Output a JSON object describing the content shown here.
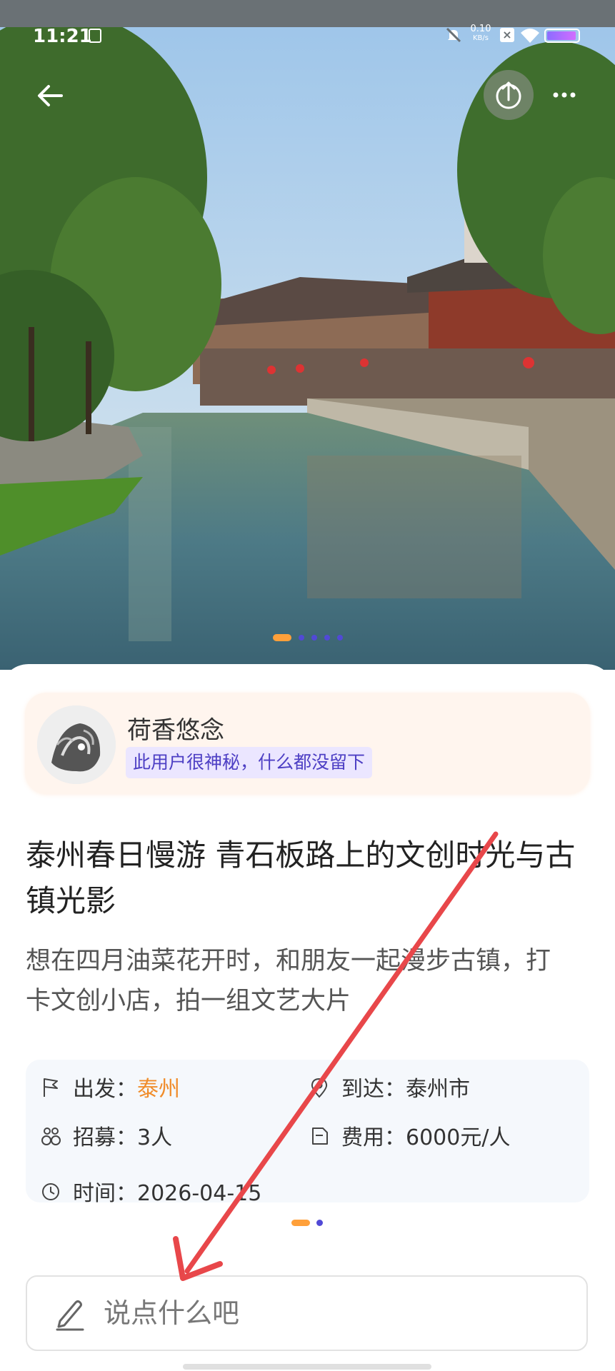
{
  "status_bar": {
    "time": "11:21",
    "speed_value": "0.10",
    "speed_unit": "KB/s",
    "icons": [
      "notification-note-icon",
      "mute-bell-icon",
      "close-box-icon",
      "wifi-icon",
      "battery-icon"
    ]
  },
  "header": {
    "back_icon": "arrow-left-icon",
    "share_icon": "share-upload-icon",
    "more_icon": "more-dots-icon"
  },
  "carousel": {
    "total_slides": 5,
    "active_index": 0,
    "colors": {
      "active": "#ffa03a",
      "inactive": "#5149d6"
    }
  },
  "author": {
    "name": "荷香悠念",
    "bio": "此用户很神秘，什么都没留下"
  },
  "post": {
    "title": "泰州春日慢游 青石板路上的文创时光与古镇光影",
    "description": "想在四月油菜花开时，和朋友一起漫步古镇，打卡文创小店，拍一组文艺大片"
  },
  "info": {
    "departure_label": "出发：",
    "departure_value": "泰州",
    "arrival_label": "到达：",
    "arrival_value": "泰州市",
    "recruit_label": "招募：",
    "recruit_value": "3人",
    "cost_label": "费用：",
    "cost_value": "6000元/人",
    "time_label": "时间：",
    "time_value": "2026-04-15"
  },
  "info_pager": {
    "total": 2,
    "active_index": 0
  },
  "comment": {
    "placeholder": "说点什么吧",
    "icon": "pencil-icon"
  },
  "annotation": {
    "color": "#e8474a",
    "type": "arrow"
  }
}
